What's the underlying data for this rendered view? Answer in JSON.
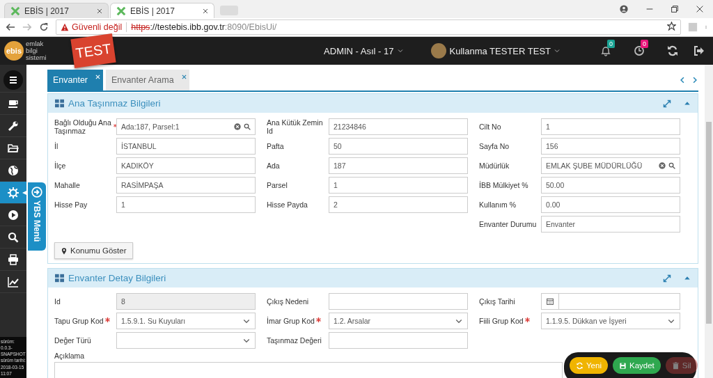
{
  "browser": {
    "tabs": [
      {
        "title": "EBİS | 2017",
        "selected": false
      },
      {
        "title": "EBİS | 2017",
        "selected": true
      }
    ],
    "address": {
      "security_warning": "Güvenli değil",
      "scheme": "https",
      "host": "://testebis.ibb.gov.tr",
      "path": ":8090/EbisUi/"
    }
  },
  "header": {
    "logo": {
      "mark": "ebis",
      "lines": [
        "emlak",
        "bilgi",
        "sistemi"
      ]
    },
    "env_badge": "TEST",
    "role_menu": "ADMIN - Asıl - 17",
    "user_menu": "Kullanma TESTER TEST",
    "counters": [
      {
        "kind": "bell",
        "count": "0",
        "color": "#1aa394"
      },
      {
        "kind": "clock",
        "count": "0",
        "color": "#e8157a"
      }
    ]
  },
  "sidebar": {
    "items": [
      {
        "kind": "menu",
        "selected": false
      },
      {
        "kind": "cup",
        "selected": false
      },
      {
        "kind": "wrench",
        "selected": false
      },
      {
        "kind": "folder",
        "selected": false
      },
      {
        "kind": "globe",
        "selected": false
      },
      {
        "kind": "gear",
        "selected": true
      },
      {
        "kind": "play",
        "selected": false
      },
      {
        "kind": "search",
        "selected": false
      },
      {
        "kind": "print",
        "selected": false
      },
      {
        "kind": "chart",
        "selected": false
      }
    ],
    "side_tab": "YBS Menü",
    "version_lines": [
      "sürüm:",
      "0.0.3-",
      "SNAPSHOT",
      "sürüm tarihi:",
      "2018-03-15",
      "11:07"
    ]
  },
  "tabs": [
    {
      "label": "Envanter",
      "selected": true
    },
    {
      "label": "Envanter Arama",
      "selected": false
    }
  ],
  "panels": [
    {
      "title": "Ana Taşınmaz Bilgileri",
      "columns": [
        [
          {
            "label": "Bağlı Olduğu Ana Taşınmaz",
            "value": "Ada:187, Parsel:1",
            "kind": "lookup",
            "required": true,
            "disabled": false
          },
          {
            "label": "İl",
            "value": "İSTANBUL",
            "kind": "text",
            "required": false,
            "disabled": false
          },
          {
            "label": "İlçe",
            "value": "KADIKÖY",
            "kind": "text",
            "required": false,
            "disabled": false
          },
          {
            "label": "Mahalle",
            "value": "RASİMPAŞA",
            "kind": "text",
            "required": false,
            "disabled": false
          },
          {
            "label": "Hisse Pay",
            "value": "1",
            "kind": "text",
            "required": false,
            "disabled": false
          }
        ],
        [
          {
            "label": "Ana Kütük Zemin Id",
            "value": "21234846",
            "kind": "text",
            "required": false,
            "disabled": false
          },
          {
            "label": "Pafta",
            "value": "50",
            "kind": "text",
            "required": false,
            "disabled": false
          },
          {
            "label": "Ada",
            "value": "187",
            "kind": "text",
            "required": false,
            "disabled": false
          },
          {
            "label": "Parsel",
            "value": "1",
            "kind": "text",
            "required": false,
            "disabled": false
          },
          {
            "label": "Hisse Payda",
            "value": "2",
            "kind": "text",
            "required": false,
            "disabled": false
          }
        ],
        [
          {
            "label": "Cilt No",
            "value": "1",
            "kind": "text",
            "required": false,
            "disabled": false
          },
          {
            "label": "Sayfa No",
            "value": "156",
            "kind": "text",
            "required": false,
            "disabled": false
          },
          {
            "label": "Müdürlük",
            "value": "EMLAK ŞUBE MÜDÜRLÜĞÜ",
            "kind": "lookup",
            "required": false,
            "disabled": false
          },
          {
            "label": "İBB Mülkiyet %",
            "value": "50.00",
            "kind": "text",
            "required": false,
            "disabled": false
          },
          {
            "label": "Kullanım %",
            "value": "0.00",
            "kind": "text",
            "required": false,
            "disabled": false
          },
          {
            "label": "Envanter Durumu",
            "value": "Envanter",
            "kind": "text",
            "required": false,
            "disabled": false
          }
        ]
      ],
      "button": "Konumu Göster"
    },
    {
      "title": "Envanter Detay Bilgileri",
      "columns": [
        [
          {
            "label": "Id",
            "value": "8",
            "kind": "text",
            "required": false,
            "disabled": true
          },
          {
            "label": "Tapu Grup Kod",
            "value": "1.5.9.1. Su Kuyuları",
            "kind": "select",
            "required": true,
            "disabled": false
          },
          {
            "label": "Değer Türü",
            "kind": "select",
            "required": false,
            "disabled": false
          }
        ],
        [
          {
            "label": "Çıkış Nedeni",
            "kind": "text",
            "required": false,
            "disabled": false
          },
          {
            "label": "İmar Grup Kod",
            "value": "1.2. Arsalar",
            "kind": "select",
            "required": true,
            "disabled": false
          },
          {
            "label": "Taşınmaz Değeri",
            "kind": "text",
            "required": false,
            "disabled": false
          }
        ],
        [
          {
            "label": "Çıkış Tarihi",
            "kind": "date",
            "required": false,
            "disabled": false
          },
          {
            "label": "Fiili Grup Kod",
            "value": "1.1.9.5. Dükkan ve İşyeri",
            "kind": "select",
            "required": true,
            "disabled": false
          }
        ]
      ],
      "textarea": {
        "label": "Açıklama"
      }
    }
  ],
  "actions": [
    {
      "label": "Yeni",
      "kind": "new",
      "disabled": false
    },
    {
      "label": "Kaydet",
      "kind": "save",
      "disabled": false
    },
    {
      "label": "Sil",
      "kind": "delete",
      "disabled": true
    }
  ]
}
